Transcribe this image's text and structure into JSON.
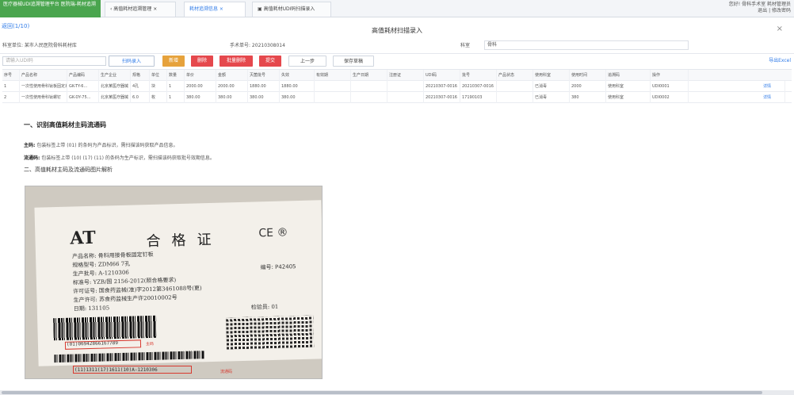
{
  "tabs": {
    "home": "医疗器械UDI追溯管理平台 医院端-耗材追溯",
    "tab1": "‹ 高值耗材追溯管理 ×",
    "tab2": "耗材追溯信息 ×",
    "tab3": "▣ 高值耗材UDI码扫描录入"
  },
  "user": {
    "line1": "您好! 骨科手术室 耗材管理员",
    "line2": "退出 | 修改密码"
  },
  "page": {
    "back_link": "返回(1/10)",
    "modal_title": "高值耗材扫描录入",
    "close": "×"
  },
  "info": {
    "hospital": "科室单位: 某市人民医院骨科耗材库",
    "surgery_no": "手术单号: 20210308014",
    "dept_label": "科室",
    "dept_value": "骨科"
  },
  "toolbar": {
    "search_placeholder": "请输入UDI码",
    "scan_btn": "扫码录入",
    "add_btn": "新增",
    "delete_btn": "删除",
    "batch_btn": "批量删除",
    "submit_btn": "提交",
    "prev_btn": "上一步",
    "save_btn": "保存草稿",
    "right_link": "导出Excel"
  },
  "table": {
    "headers": [
      "序号",
      "产品名称",
      "产品编码",
      "生产企业",
      "规格",
      "单位",
      "数量",
      "单价",
      "金额",
      "灭菌批号",
      "失效",
      "有效期",
      "生产日期",
      "注册证",
      "UDI码",
      "批号",
      "产品状态",
      "使用科室",
      "使用时间",
      "追溯码",
      "操作"
    ],
    "rows": [
      [
        "1",
        "一次性使用骨科钛板固定系统",
        "GK-TY-6...",
        "北京某医疗器械",
        "4孔",
        "块",
        "1",
        "2000.00",
        "2000.00",
        "1880.00",
        "1880.00",
        "",
        "",
        "",
        "20210307-0016",
        "20210307-0016",
        "",
        "已消毒",
        "2000",
        "使用科室",
        "UDI0001",
        "详情"
      ],
      [
        "2",
        "一次性使用骨科钛螺钉",
        "GK-DY-75...",
        "北京某医疗器械",
        "6.0",
        "枚",
        "1",
        "380.00",
        "380.00",
        "380.00",
        "380.00",
        "",
        "",
        "",
        "20210307-0016",
        "17190103",
        "",
        "已消毒",
        "380",
        "使用科室",
        "UDI0002",
        "详情"
      ]
    ]
  },
  "guide": {
    "heading1": "一、识别高值耗材主码流通码",
    "p1_label": "主码:",
    "p1_text": "包装标签上带 (01) 的条码为产品标识，需扫描该码获取产品信息。",
    "p2_label": "流通码:",
    "p2_text": "包装标签上带 (10) (17) (11) 的条码为生产标识，需扫描该码获取批号效期信息。",
    "heading2": "二、高值耗材主码及流通码图片解析"
  },
  "label_photo": {
    "brand": "AT",
    "title": "合格证",
    "ce": "CE ®",
    "lines": [
      "产品名称: 骨科用接骨板固定钉板",
      "规格型号: ZDM66  7孔",
      "生产批号: A-1210306",
      "标准号: YZB/国 2156-2012(照合格要求)",
      "许可证号: 国食药监械(准)字2012第3461088号(更)",
      "生产许可: 苏食药监械生产许20010002号",
      "日期: 131105"
    ],
    "number": "编号: P42405",
    "check": "检验员: 01",
    "barcode1_text": "(01)06942866167789",
    "barcode2_text": "(11)1311(17)1611(10)A-1210306",
    "anno1": "主码",
    "anno2": "流通码"
  }
}
